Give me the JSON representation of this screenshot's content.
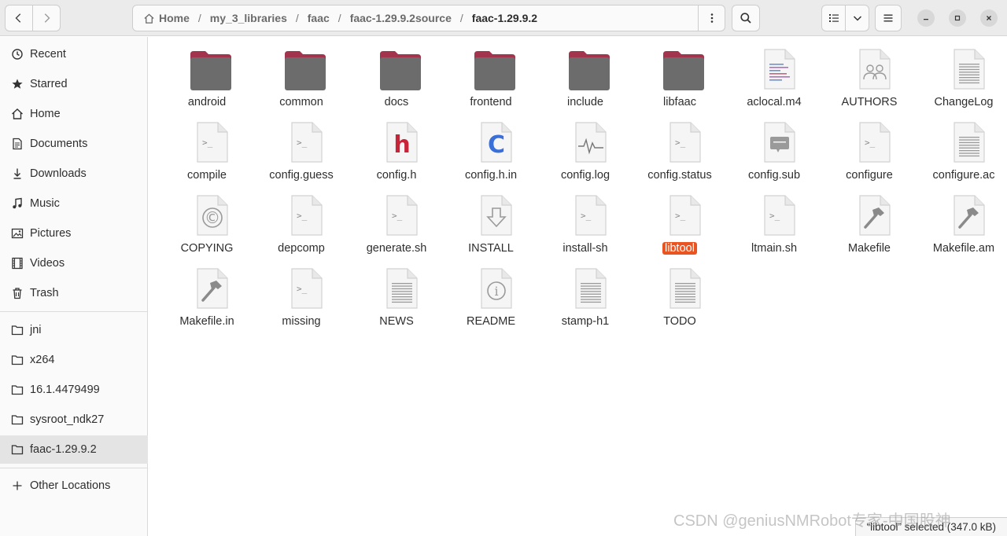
{
  "breadcrumbs": [
    {
      "label": "Home",
      "icon": "home-icon"
    },
    {
      "label": "my_3_libraries"
    },
    {
      "label": "faac"
    },
    {
      "label": "faac-1.29.9.2source"
    },
    {
      "label": "faac-1.29.9.2"
    }
  ],
  "breadcrumb_separator": "/",
  "sidebar": {
    "places": [
      {
        "label": "Recent",
        "icon": "clock-icon"
      },
      {
        "label": "Starred",
        "icon": "star-icon"
      },
      {
        "label": "Home",
        "icon": "home-icon"
      },
      {
        "label": "Documents",
        "icon": "document-icon"
      },
      {
        "label": "Downloads",
        "icon": "download-icon"
      },
      {
        "label": "Music",
        "icon": "music-icon"
      },
      {
        "label": "Pictures",
        "icon": "pictures-icon"
      },
      {
        "label": "Videos",
        "icon": "video-icon"
      },
      {
        "label": "Trash",
        "icon": "trash-icon"
      }
    ],
    "bookmarks": [
      {
        "label": "jni",
        "icon": "folder-icon"
      },
      {
        "label": "x264",
        "icon": "folder-icon"
      },
      {
        "label": "16.1.4479499",
        "icon": "folder-icon"
      },
      {
        "label": "sysroot_ndk27",
        "icon": "folder-icon"
      },
      {
        "label": "faac-1.29.9.2",
        "icon": "folder-icon",
        "active": true
      }
    ],
    "other": {
      "label": "Other Locations",
      "icon": "plus-icon"
    }
  },
  "files": [
    {
      "name": "android",
      "type": "folder"
    },
    {
      "name": "common",
      "type": "folder"
    },
    {
      "name": "docs",
      "type": "folder"
    },
    {
      "name": "frontend",
      "type": "folder"
    },
    {
      "name": "include",
      "type": "folder"
    },
    {
      "name": "libfaac",
      "type": "folder"
    },
    {
      "name": "aclocal.m4",
      "type": "m4"
    },
    {
      "name": "AUTHORS",
      "type": "authors"
    },
    {
      "name": "ChangeLog",
      "type": "text"
    },
    {
      "name": "compile",
      "type": "script"
    },
    {
      "name": "config.guess",
      "type": "script"
    },
    {
      "name": "config.h",
      "type": "header"
    },
    {
      "name": "config.h.in",
      "type": "csource"
    },
    {
      "name": "config.log",
      "type": "log"
    },
    {
      "name": "config.status",
      "type": "script"
    },
    {
      "name": "config.sub",
      "type": "chat"
    },
    {
      "name": "configure",
      "type": "script"
    },
    {
      "name": "configure.ac",
      "type": "text"
    },
    {
      "name": "COPYING",
      "type": "copyright"
    },
    {
      "name": "depcomp",
      "type": "script"
    },
    {
      "name": "generate.sh",
      "type": "script"
    },
    {
      "name": "INSTALL",
      "type": "install"
    },
    {
      "name": "install-sh",
      "type": "script"
    },
    {
      "name": "libtool",
      "type": "script",
      "selected": true
    },
    {
      "name": "ltmain.sh",
      "type": "script"
    },
    {
      "name": "Makefile",
      "type": "makefile"
    },
    {
      "name": "Makefile.am",
      "type": "makefile"
    },
    {
      "name": "Makefile.in",
      "type": "makefile"
    },
    {
      "name": "missing",
      "type": "script"
    },
    {
      "name": "NEWS",
      "type": "text"
    },
    {
      "name": "README",
      "type": "info"
    },
    {
      "name": "stamp-h1",
      "type": "text"
    },
    {
      "name": "TODO",
      "type": "text"
    }
  ],
  "icon_glyphs": {
    "header": "h",
    "csource": "C",
    "copyright": "©",
    "info": "i",
    "script": ">_"
  },
  "status": "“libtool” selected (347.0 kB)",
  "watermark": "CSDN @geniusNMRobot专家-中国股神",
  "colors": {
    "accent": "#e95420",
    "folder_tab": "#a2344e",
    "folder_body": "#6c6c6c",
    "header_glyph": "#c7243a",
    "c_glyph": "#3b6fd8"
  }
}
